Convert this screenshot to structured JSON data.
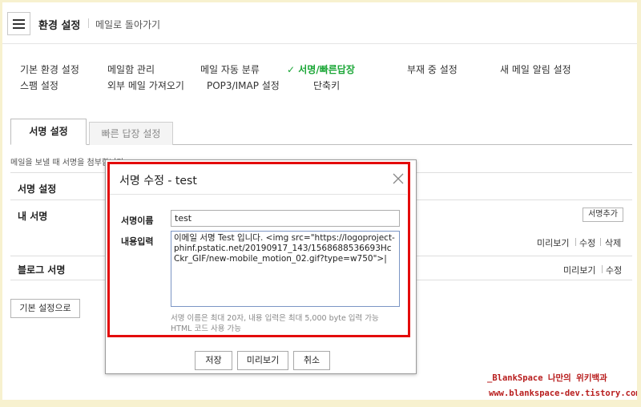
{
  "header": {
    "title": "환경 설정",
    "back_link": "메일로 돌아가기"
  },
  "settings_nav": [
    {
      "label": "기본 환경 설정",
      "active": false
    },
    {
      "label": "메일함 관리",
      "active": false
    },
    {
      "label": "메일 자동 분류",
      "active": false
    },
    {
      "label": "✓ 서명/빠른답장",
      "active": true
    },
    {
      "label": "부재 중 설정",
      "active": false
    },
    {
      "label": "새 메일 알림 설정",
      "active": false
    },
    {
      "label": "스팸 설정",
      "active": false
    },
    {
      "label": "외부 메일 가져오기",
      "active": false
    },
    {
      "label": "POP3/IMAP 설정",
      "active": false
    },
    {
      "label": "단축키",
      "active": false
    }
  ],
  "tabs": [
    {
      "label": "서명 설정",
      "active": true
    },
    {
      "label": "빠른 답장 설정",
      "active": false
    }
  ],
  "description": "메일을 보낼 때 서명을 첨부합니다.",
  "sections": {
    "signature_setting": "서명 설정",
    "my_signature": "내 서명",
    "blog_signature": "블로그 서명"
  },
  "buttons": {
    "add_signature": "서명추가",
    "default_settings": "기본 설정으로"
  },
  "my_signature_actions": [
    "미리보기",
    "수정",
    "삭제"
  ],
  "blog_signature_actions": [
    "미리보기",
    "수정"
  ],
  "dialog": {
    "title": "서명 수정 - test",
    "name_label": "서명이름",
    "name_value": "test",
    "content_label": "내용입력",
    "content_value": "이메일 서명 Test 입니다. <img src=\"https://logoproject-phinf.pstatic.net/20190917_143/1568688536693HcCkr_GIF/new-mobile_motion_02.gif?type=w750\">|",
    "note_line1": "서명 이름은 최대 20자, 내용 입력은 최대 5,000 byte 입력 가능",
    "note_line2": "HTML 코드 사용 가능",
    "save": "저장",
    "preview": "미리보기",
    "cancel": "취소"
  },
  "watermark": {
    "line1": "_BlankSpace 나만의 위키백과",
    "line2": "www.blankspace-dev.tistory.com"
  },
  "colors": {
    "active_nav": "#1aa636",
    "highlight": "#e30b0b",
    "frame": "#f7f1cf",
    "watermark": "#b81d1d"
  }
}
